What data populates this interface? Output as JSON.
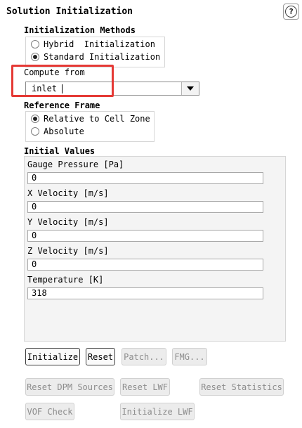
{
  "panel": {
    "title": "Solution Initialization"
  },
  "help": {
    "glyph": "?"
  },
  "init_methods": {
    "title": "Initialization Methods",
    "options": [
      {
        "label": "Hybrid  Initialization",
        "selected": false
      },
      {
        "label": "Standard Initialization",
        "selected": true
      }
    ]
  },
  "compute_from": {
    "label": "Compute from",
    "value": "inlet"
  },
  "reference_frame": {
    "title": "Reference Frame",
    "options": [
      {
        "label": "Relative to Cell Zone",
        "selected": true
      },
      {
        "label": "Absolute",
        "selected": false
      }
    ]
  },
  "initial_values": {
    "title": "Initial Values",
    "fields": [
      {
        "label": "Gauge Pressure [Pa]",
        "value": "0"
      },
      {
        "label": "X Velocity [m/s]",
        "value": "0"
      },
      {
        "label": "Y Velocity [m/s]",
        "value": "0"
      },
      {
        "label": "Z Velocity [m/s]",
        "value": "0"
      },
      {
        "label": "Temperature [K]",
        "value": "318"
      }
    ]
  },
  "buttons": {
    "initialize": "Initialize",
    "reset": "Reset",
    "patch": "Patch...",
    "fmg": "FMG...",
    "reset_dpm": "Reset DPM Sources",
    "reset_lwf": "Reset LWF",
    "reset_stats": "Reset Statistics",
    "vof_check": "VOF Check",
    "initialize_lwf": "Initialize LWF"
  }
}
